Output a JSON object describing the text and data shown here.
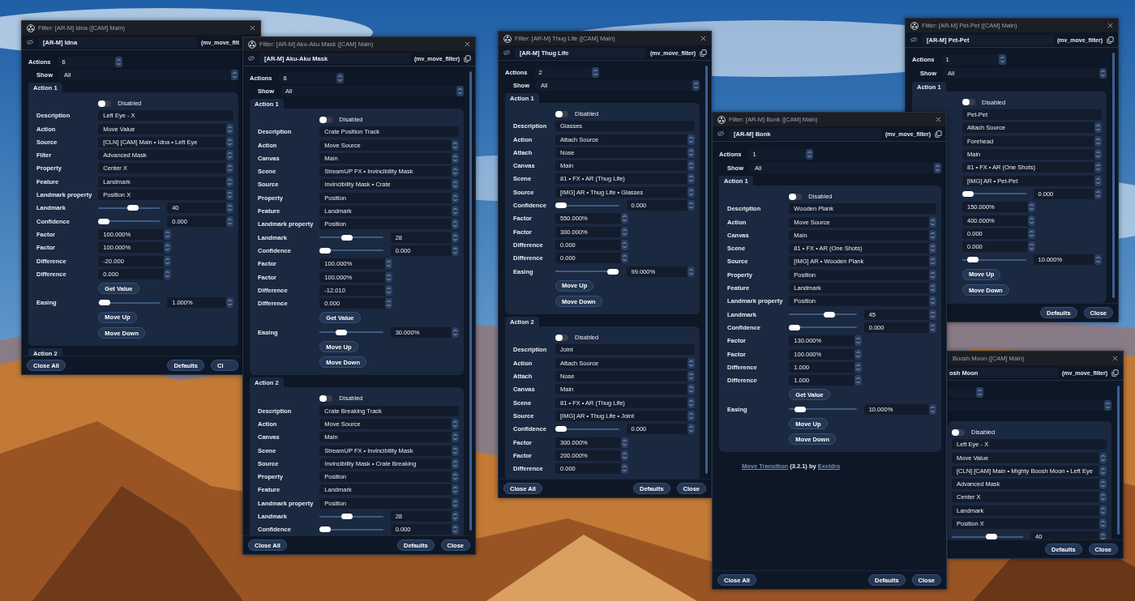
{
  "windows": [
    {
      "title": "Filter: [AR-M] Idna ([CAM] Main)",
      "name": "[AR-M] Idna",
      "filter_id": "(mv_move_filt",
      "actions": {
        "label": "Actions",
        "value": "6"
      },
      "show": {
        "label": "Show",
        "value": "All"
      },
      "groups": [
        {
          "title": "Action 1",
          "rows": [
            {
              "kind": "toggle",
              "text": "Disabled",
              "on": false
            },
            {
              "kind": "text",
              "label": "Description",
              "value": "Left Eye - X"
            },
            {
              "kind": "select",
              "label": "Action",
              "value": "Move Value"
            },
            {
              "kind": "select",
              "label": "Source",
              "value": "[CLN] [CAM] Main • Idna • Left Eye"
            },
            {
              "kind": "select",
              "label": "Filter",
              "value": "Advanced Mask"
            },
            {
              "kind": "select",
              "label": "Property",
              "value": "Center X"
            },
            {
              "kind": "select",
              "label": "Feature",
              "value": "Landmark"
            },
            {
              "kind": "select",
              "label": "Landmark property",
              "value": "Position X"
            },
            {
              "kind": "slider",
              "label": "Landmark",
              "level": 0.57,
              "value": "40"
            },
            {
              "kind": "slider",
              "label": "Confidence",
              "level": 0,
              "value": "0.000"
            },
            {
              "kind": "number",
              "label": "Factor",
              "value": "100.000%"
            },
            {
              "kind": "number",
              "label": "Factor",
              "value": "100.000%"
            },
            {
              "kind": "number",
              "label": "Difference",
              "value": "-20.000"
            },
            {
              "kind": "number",
              "label": "Difference",
              "value": "0.000"
            },
            {
              "kind": "button",
              "text": "Get Value"
            },
            {
              "kind": "slider",
              "label": "Easing",
              "level": 0.01,
              "value": "1.000%"
            },
            {
              "kind": "button",
              "text": "Move Up"
            },
            {
              "kind": "button",
              "text": "Move Down"
            }
          ]
        },
        {
          "title": "Action 2"
        }
      ],
      "footer": {
        "left": [
          "Close All"
        ],
        "right": [
          "Defaults",
          "Cl"
        ]
      }
    },
    {
      "title": "Filter: [AR-M] Aku-Aku Mask ([CAM] Main)",
      "name": "[AR-M] Aku-Aku Mask",
      "filter_id": "(mv_move_filter)",
      "actions": {
        "label": "Actions",
        "value": "6"
      },
      "show": {
        "label": "Show",
        "value": "All"
      },
      "groups": [
        {
          "title": "Action 1",
          "rows": [
            {
              "kind": "toggle",
              "text": "Disabled",
              "on": false
            },
            {
              "kind": "text",
              "label": "Description",
              "value": "Crate Position Track"
            },
            {
              "kind": "select",
              "label": "Action",
              "value": "Move Source"
            },
            {
              "kind": "select",
              "label": "Canvas",
              "value": "Main"
            },
            {
              "kind": "select",
              "label": "Scene",
              "value": "StreamUP FX • Invincibility Mask"
            },
            {
              "kind": "select",
              "label": "Source",
              "value": "Invincibility Mask • Crate"
            },
            {
              "kind": "select",
              "label": "Property",
              "value": "Position"
            },
            {
              "kind": "select",
              "label": "Feature",
              "value": "Landmark"
            },
            {
              "kind": "select",
              "label": "Landmark property",
              "value": "Position"
            },
            {
              "kind": "slider",
              "label": "Landmark",
              "level": 0.41,
              "value": "28"
            },
            {
              "kind": "slider",
              "label": "Confidence",
              "level": 0,
              "value": "0.000"
            },
            {
              "kind": "number",
              "label": "Factor",
              "value": "100.000%"
            },
            {
              "kind": "number",
              "label": "Factor",
              "value": "100.000%"
            },
            {
              "kind": "number",
              "label": "Difference",
              "value": "-12.010"
            },
            {
              "kind": "number",
              "label": "Difference",
              "value": "0.000"
            },
            {
              "kind": "button",
              "text": "Get Value"
            },
            {
              "kind": "slider",
              "label": "Easing",
              "level": 0.3,
              "value": "30.000%"
            },
            {
              "kind": "button",
              "text": "Move Up"
            },
            {
              "kind": "button",
              "text": "Move Down"
            }
          ]
        },
        {
          "title": "Action 2",
          "rows": [
            {
              "kind": "toggle",
              "text": "Disabled",
              "on": false
            },
            {
              "kind": "text",
              "label": "Description",
              "value": "Crate Breaking Track"
            },
            {
              "kind": "select",
              "label": "Action",
              "value": "Move Source"
            },
            {
              "kind": "select",
              "label": "Canvas",
              "value": "Main"
            },
            {
              "kind": "select",
              "label": "Scene",
              "value": "StreamUP FX • Invincibility Mask"
            },
            {
              "kind": "select",
              "label": "Source",
              "value": "Invincibility Mask • Crate Breaking"
            },
            {
              "kind": "select",
              "label": "Property",
              "value": "Position"
            },
            {
              "kind": "select",
              "label": "Feature",
              "value": "Landmark"
            },
            {
              "kind": "select",
              "label": "Landmark property",
              "value": "Position"
            },
            {
              "kind": "slider",
              "label": "Landmark",
              "level": 0.41,
              "value": "28"
            },
            {
              "kind": "slider",
              "label": "Confidence",
              "level": 0,
              "value": "0.000"
            }
          ]
        }
      ],
      "footer": {
        "left": [
          "Close All"
        ],
        "right": [
          "Defaults",
          "Close"
        ]
      }
    },
    {
      "title": "Filter: [AR-M] Thug Life ([CAM] Main)",
      "name": "[AR-M] Thug Life",
      "filter_id": "(mv_move_filter)",
      "actions": {
        "label": "Actions",
        "value": "2"
      },
      "show": {
        "label": "Show",
        "value": "All"
      },
      "groups": [
        {
          "title": "Action 1",
          "rows": [
            {
              "kind": "toggle",
              "text": "Disabled",
              "on": false
            },
            {
              "kind": "text",
              "label": "Description",
              "value": "Glasses"
            },
            {
              "kind": "select",
              "label": "Action",
              "value": "Attach Source"
            },
            {
              "kind": "select",
              "label": "Attach",
              "value": "Nose"
            },
            {
              "kind": "select",
              "label": "Canvas",
              "value": "Main"
            },
            {
              "kind": "select",
              "label": "Scene",
              "value": "81 • FX • AR (Thug Life)"
            },
            {
              "kind": "select",
              "label": "Source",
              "value": "[IMG] AR • Thug Life • Glasses"
            },
            {
              "kind": "slider",
              "label": "Confidence",
              "level": 0,
              "value": "0.000"
            },
            {
              "kind": "number",
              "label": "Factor",
              "value": "550.000%"
            },
            {
              "kind": "number",
              "label": "Factor",
              "value": "300.000%"
            },
            {
              "kind": "number",
              "label": "Difference",
              "value": "0.000"
            },
            {
              "kind": "number",
              "label": "Difference",
              "value": "0.000"
            },
            {
              "kind": "slider",
              "label": "Easing",
              "level": 0.99,
              "value": "99.000%"
            },
            {
              "kind": "button",
              "text": "Move Up"
            },
            {
              "kind": "button",
              "text": "Move Down"
            }
          ]
        },
        {
          "title": "Action 2",
          "rows": [
            {
              "kind": "toggle",
              "text": "Disabled",
              "on": false
            },
            {
              "kind": "text",
              "label": "Description",
              "value": "Joint"
            },
            {
              "kind": "select",
              "label": "Action",
              "value": "Attach Source"
            },
            {
              "kind": "select",
              "label": "Attach",
              "value": "Nose"
            },
            {
              "kind": "select",
              "label": "Canvas",
              "value": "Main"
            },
            {
              "kind": "select",
              "label": "Scene",
              "value": "81 • FX • AR (Thug Life)"
            },
            {
              "kind": "select",
              "label": "Source",
              "value": "[IMG] AR • Thug Life • Joint"
            },
            {
              "kind": "slider",
              "label": "Confidence",
              "level": 0,
              "value": "0.000"
            },
            {
              "kind": "number",
              "label": "Factor",
              "value": "300.000%"
            },
            {
              "kind": "number",
              "label": "Factor",
              "value": "200.000%"
            },
            {
              "kind": "number",
              "label": "Difference",
              "value": "0.000"
            }
          ]
        }
      ],
      "footer": {
        "left": [
          "Close All"
        ],
        "right": [
          "Defaults",
          "Close"
        ]
      }
    },
    {
      "title": "Filter: [AR-M] Pet-Pet ([CAM] Main)",
      "name": "[AR-M] Pet-Pet",
      "filter_id": "(mv_move_filter)",
      "actions": {
        "label": "Actions",
        "value": "1"
      },
      "show": {
        "label": "Show",
        "value": "All"
      },
      "groups": [
        {
          "title": "Action 1",
          "rows": [
            {
              "kind": "toggle",
              "text": "Disabled",
              "on": false
            },
            {
              "kind": "text",
              "value": "Pet-Pet"
            },
            {
              "kind": "select",
              "value": "Attach Source"
            },
            {
              "kind": "select",
              "value": "Forehead"
            },
            {
              "kind": "select",
              "value": "Main"
            },
            {
              "kind": "select",
              "value": "81 • FX • AR (One Shots)"
            },
            {
              "kind": "select",
              "value": "[IMG] AR • Pet-Pet"
            },
            {
              "kind": "slider",
              "level": 0,
              "value": "0.000"
            },
            {
              "kind": "number",
              "value": "150.000%"
            },
            {
              "kind": "number",
              "value": "400.000%"
            },
            {
              "kind": "number",
              "value": "0.000"
            },
            {
              "kind": "number",
              "value": "0.000"
            },
            {
              "kind": "slider",
              "level": 0.1,
              "value": "10.000%"
            },
            {
              "kind": "button",
              "text": "Move Up"
            },
            {
              "kind": "button",
              "text": "Move Down"
            }
          ]
        }
      ],
      "footer": {
        "right": [
          "Defaults",
          "Close"
        ]
      }
    },
    {
      "title": "Boosh Moon ([CAM] Main)",
      "name": "osh Moon",
      "filter_id": "(mv_move_filter)",
      "groups": [
        {
          "rows": [
            {
              "kind": "toggle",
              "text": "Disabled",
              "on": false
            },
            {
              "kind": "text",
              "value": "Left Eye - X"
            },
            {
              "kind": "select",
              "value": "Move Value"
            },
            {
              "kind": "select",
              "value": "[CLN] [CAM] Main • Mighty Boosh Moon • Left Eye"
            },
            {
              "kind": "select",
              "value": "Advanced Mask"
            },
            {
              "kind": "select",
              "value": "Center X"
            },
            {
              "kind": "select",
              "value": "Landmark"
            },
            {
              "kind": "select",
              "value": "Position X"
            },
            {
              "kind": "slider",
              "level": 0.57,
              "value": "40"
            }
          ]
        }
      ],
      "footer": {
        "right": [
          "Defaults",
          "Close"
        ]
      }
    },
    {
      "title": "Filter: [AR-M] Bonk ([CAM] Main)",
      "name": "[AR-M] Bonk",
      "filter_id": "(mv_move_filter)",
      "actions": {
        "label": "Actions",
        "value": "1"
      },
      "show": {
        "label": "Show",
        "value": "All"
      },
      "groups": [
        {
          "title": "Action 1",
          "rows": [
            {
              "kind": "toggle",
              "text": "Disabled",
              "on": false
            },
            {
              "kind": "text",
              "label": "Description",
              "value": "Wooden Plank"
            },
            {
              "kind": "select",
              "label": "Action",
              "value": "Move Source"
            },
            {
              "kind": "select",
              "label": "Canvas",
              "value": "Main"
            },
            {
              "kind": "select",
              "label": "Scene",
              "value": "81 • FX • AR (One Shots)"
            },
            {
              "kind": "select",
              "label": "Source",
              "value": "[IMG] AR • Wooden Plank"
            },
            {
              "kind": "select",
              "label": "Property",
              "value": "Position"
            },
            {
              "kind": "select",
              "label": "Feature",
              "value": "Landmark"
            },
            {
              "kind": "select",
              "label": "Landmark property",
              "value": "Position"
            },
            {
              "kind": "slider",
              "label": "Landmark",
              "level": 0.62,
              "value": "45"
            },
            {
              "kind": "slider",
              "label": "Confidence",
              "level": 0,
              "value": "0.000"
            },
            {
              "kind": "number",
              "label": "Factor",
              "value": "130.000%"
            },
            {
              "kind": "number",
              "label": "Factor",
              "value": "100.000%"
            },
            {
              "kind": "number",
              "label": "Difference",
              "value": "1.000"
            },
            {
              "kind": "number",
              "label": "Difference",
              "value": "1.000"
            },
            {
              "kind": "button",
              "text": "Get Value"
            },
            {
              "kind": "slider",
              "label": "Easing",
              "level": 0.1,
              "value": "10.000%"
            },
            {
              "kind": "button",
              "text": "Move Up"
            },
            {
              "kind": "button",
              "text": "Move Down"
            }
          ]
        }
      ],
      "credit": {
        "plugin": "Move Transition",
        "version": "(3.2.1) by",
        "author": "Exeldro"
      },
      "footer": {
        "left": [
          "Close All"
        ],
        "right": [
          "Defaults",
          "Close"
        ]
      }
    }
  ]
}
